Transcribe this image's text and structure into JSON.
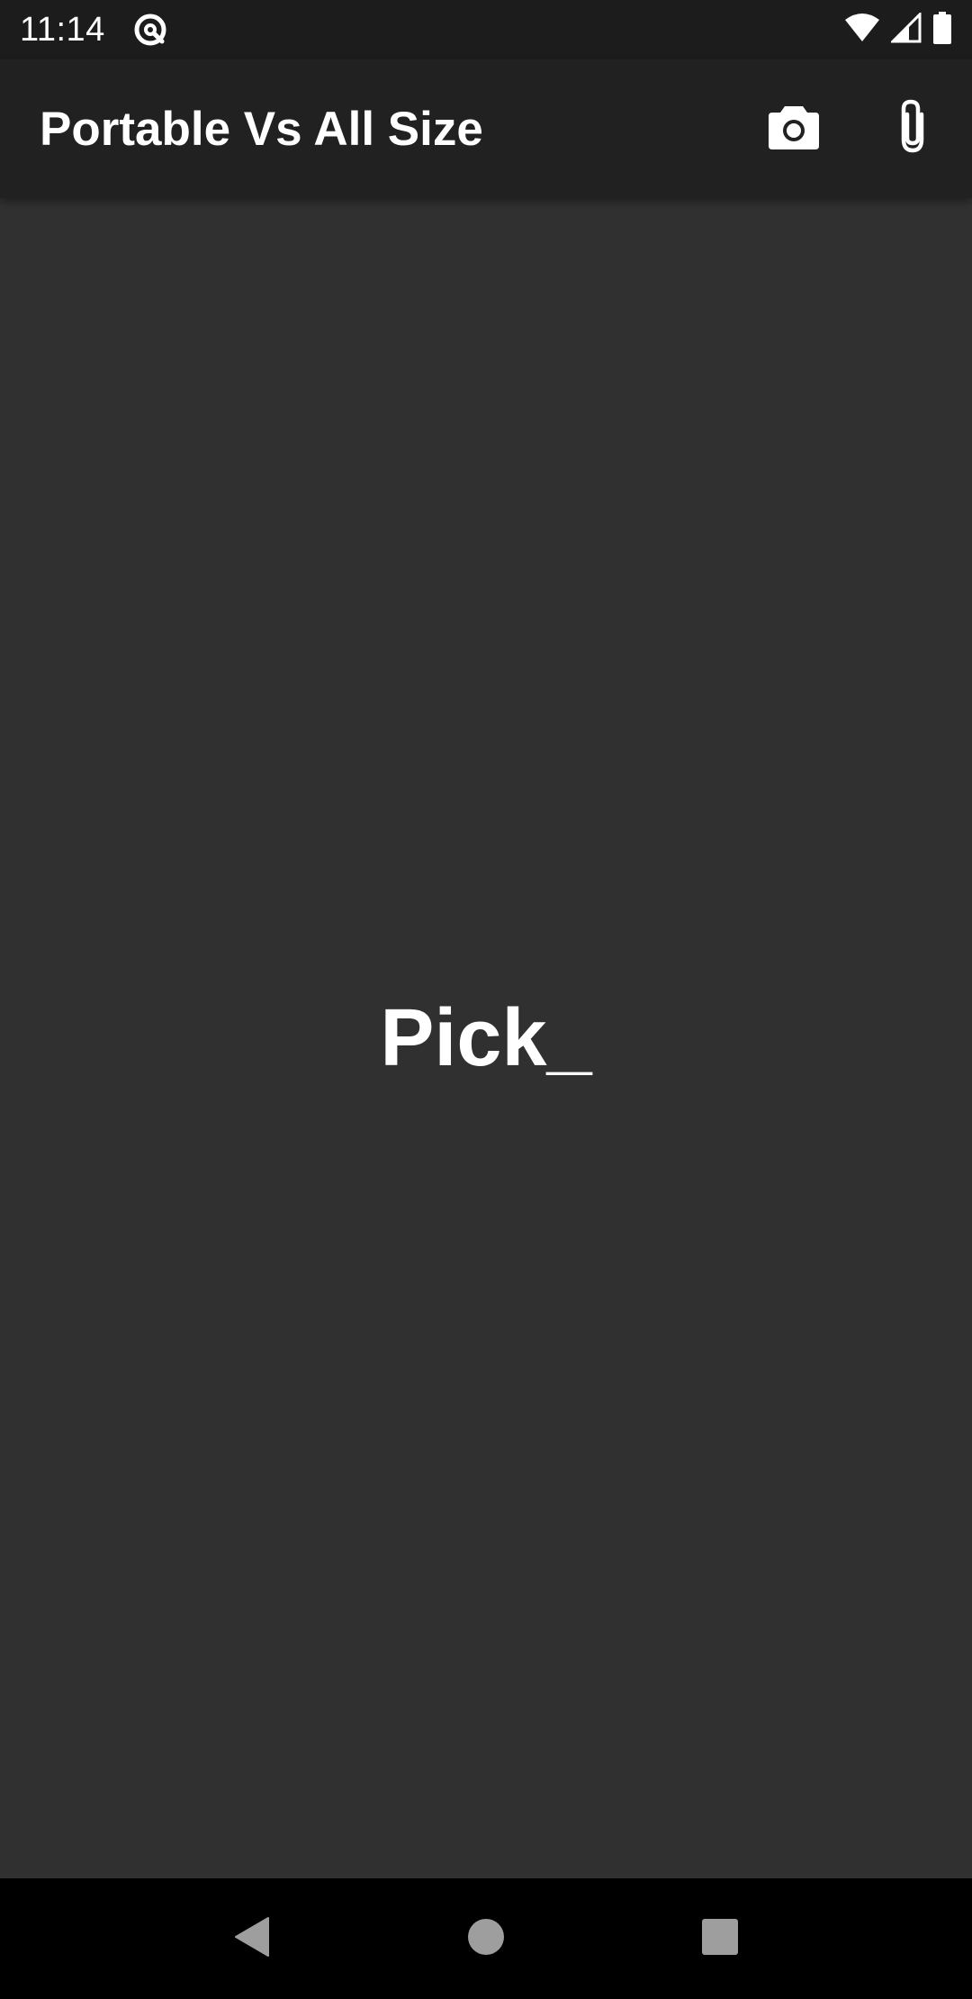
{
  "status_bar": {
    "time": "11:14",
    "app_icon": "at-sign-icon",
    "wifi_icon": "wifi-icon",
    "signal_icon": "cell-signal-icon",
    "battery_icon": "battery-icon"
  },
  "app_bar": {
    "title": "Portable Vs All Size",
    "actions": [
      {
        "icon": "camera-icon"
      },
      {
        "icon": "paperclip-icon"
      }
    ]
  },
  "main": {
    "text": "Pick_"
  },
  "nav_bar": {
    "back_icon": "back-icon",
    "home_icon": "home-icon",
    "recents_icon": "recents-icon"
  },
  "colors": {
    "status_bar_bg": "#1c1c1c",
    "app_bar_bg": "#212121",
    "content_bg": "#303030",
    "nav_bar_bg": "#000000",
    "text": "#ffffff",
    "nav_icon": "#9e9e9e"
  }
}
